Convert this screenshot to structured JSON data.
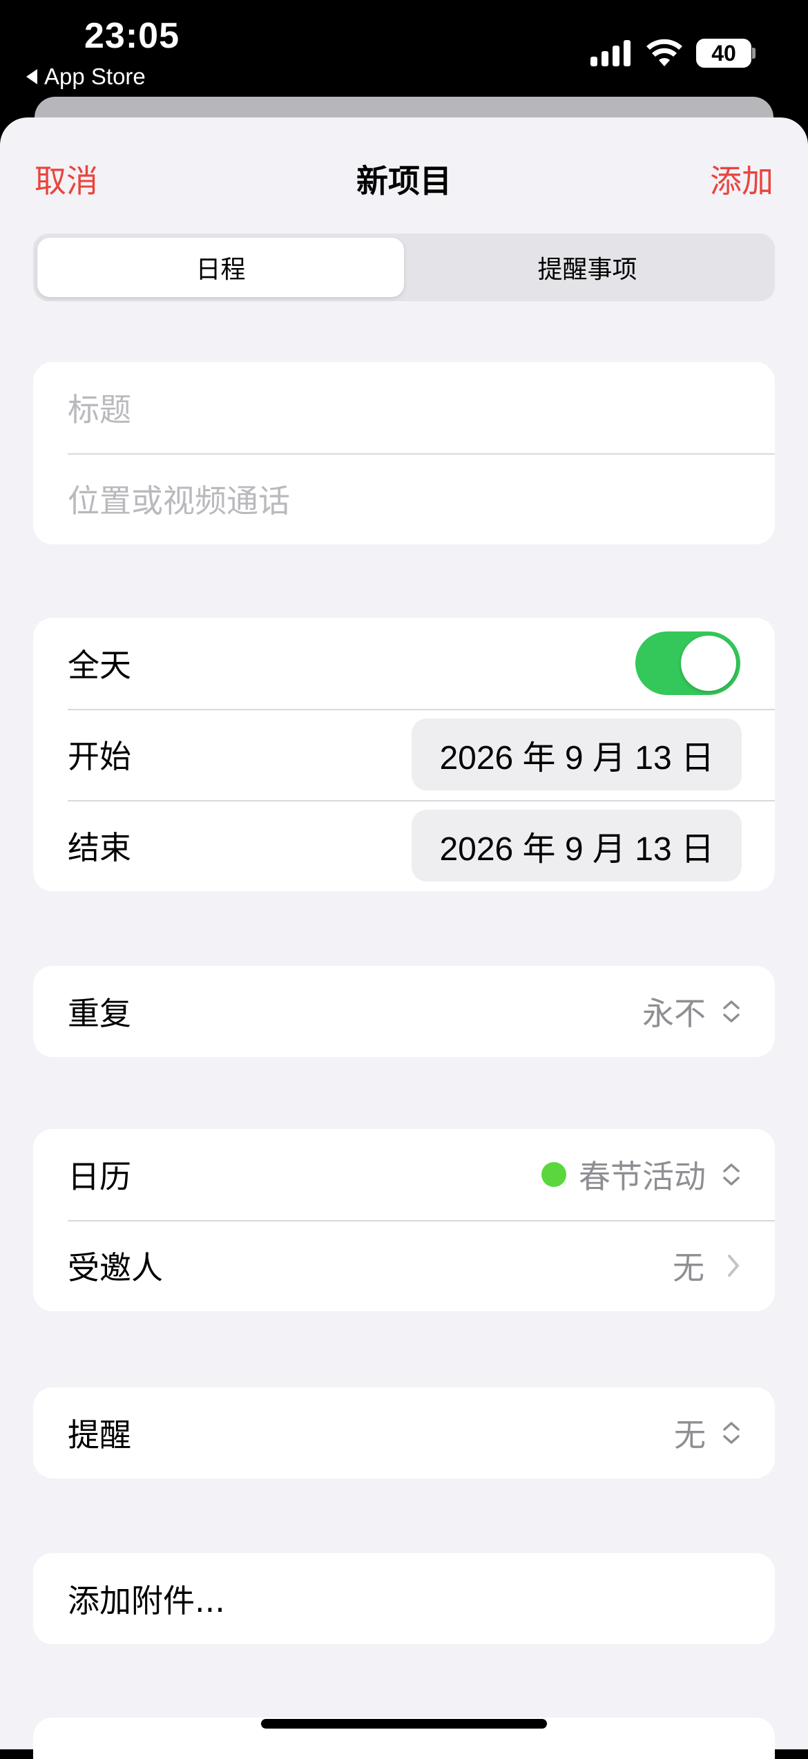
{
  "status_bar": {
    "time": "23:05",
    "back_label": "App Store",
    "battery": "40"
  },
  "nav": {
    "cancel": "取消",
    "title": "新项目",
    "add": "添加"
  },
  "segments": [
    "日程",
    "提醒事项"
  ],
  "form": {
    "title_placeholder": "标题",
    "location_placeholder": "位置或视频通话",
    "all_day_label": "全天",
    "all_day_on": true,
    "start_label": "开始",
    "start_value": "2026 年 9 月 13 日",
    "end_label": "结束",
    "end_value": "2026 年 9 月 13 日",
    "repeat_label": "重复",
    "repeat_value": "永不",
    "calendar_label": "日历",
    "calendar_value": "春节活动",
    "calendar_color": "#5ad63e",
    "invitees_label": "受邀人",
    "invitees_value": "无",
    "alert_label": "提醒",
    "alert_value": "无",
    "attachment_label": "添加附件..."
  },
  "colors": {
    "accent": "#e8453c",
    "toggle_on": "#34c759",
    "background": "#f2f2f7"
  }
}
